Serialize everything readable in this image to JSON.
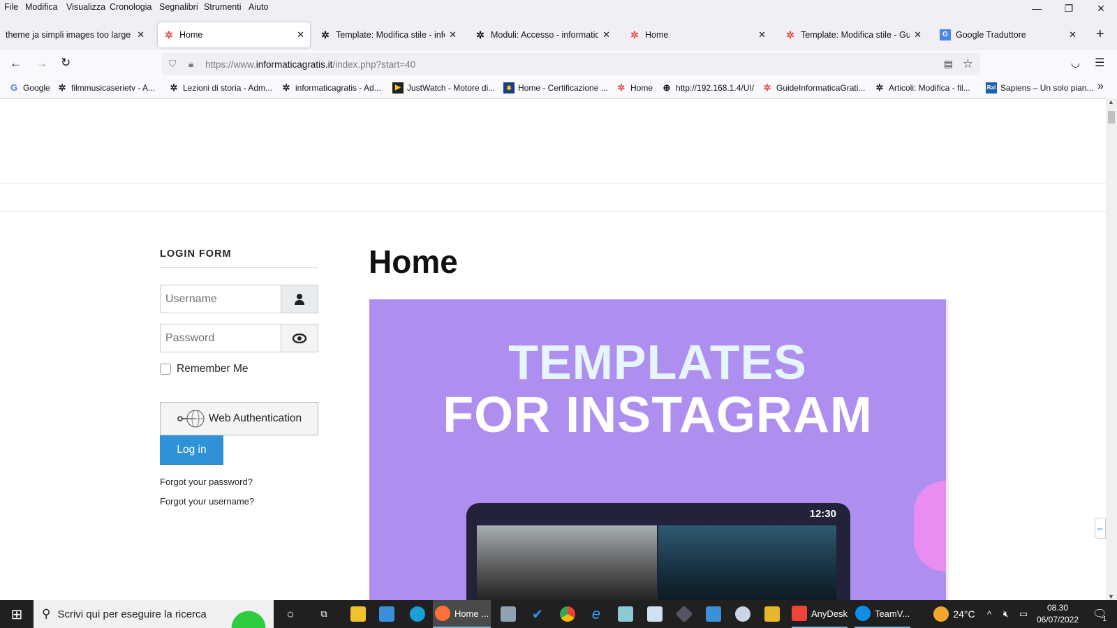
{
  "menu": [
    "File",
    "Modifica",
    "Visualizza",
    "Cronologia",
    "Segnalibri",
    "Strumenti",
    "Aiuto"
  ],
  "tabs": [
    {
      "title": "theme ja simpli images too large - S",
      "icon": "none"
    },
    {
      "title": "Home",
      "icon": "joomla-color"
    },
    {
      "title": "Template: Modifica stile - inform",
      "icon": "joomla-dark"
    },
    {
      "title": "Moduli: Accesso - informaticag",
      "icon": "joomla-dark"
    },
    {
      "title": "Home",
      "icon": "joomla-color"
    },
    {
      "title": "Template: Modifica stile - Guide",
      "icon": "joomla-color"
    },
    {
      "title": "Google Traduttore",
      "icon": "google-translate"
    }
  ],
  "url": {
    "prefix": "https://www.",
    "domain": "informaticagratis.it",
    "path": "/index.php?start=40"
  },
  "bookmarks": [
    "Google",
    "filmmusicaserietv - A...",
    "Lezioni di storia - Adm...",
    "informaticagratis - Ad...",
    "JustWatch - Motore di...",
    "Home - Certificazione ...",
    "Home",
    "http://192.168.1.4/UI/",
    "GuideInformaticaGrati...",
    "Articoli: Modifica - fil...",
    "Sapiens – Un solo pian..."
  ],
  "login": {
    "heading": "LOGIN FORM",
    "username_placeholder": "Username",
    "password_placeholder": "Password",
    "remember": "Remember Me",
    "webauthn": "Web Authentication",
    "login": "Log in",
    "forgot_password": "Forgot your password?",
    "forgot_username": "Forgot your username?"
  },
  "article": {
    "title": "Home",
    "image_line1": "TEMPLATES",
    "image_line2": "FOR INSTAGRAM",
    "phone_time": "12:30"
  },
  "taskbar": {
    "search": "Scrivi qui per eseguire la ricerca",
    "firefox": "Home ...",
    "anydesk": "AnyDesk",
    "teamviewer": "TeamV...",
    "weather": "24°C",
    "time": "08.30",
    "date": "06/07/2022",
    "notifications": "1"
  },
  "colors": {
    "accent": "#2f92d8",
    "image_bg": "#ae8ff0"
  }
}
